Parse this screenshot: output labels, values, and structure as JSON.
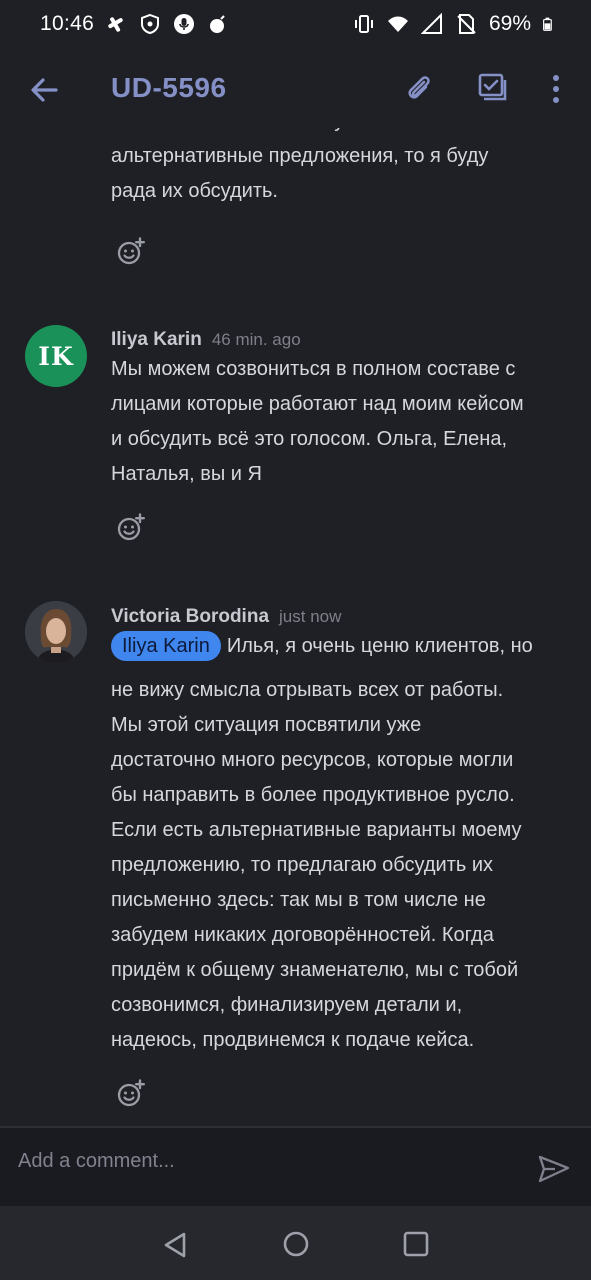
{
  "status_bar": {
    "time": "10:46",
    "battery": "69%"
  },
  "header": {
    "title": "UD-5596",
    "back_icon": "arrow-left-icon",
    "attach_icon": "paperclip-icon",
    "checklist_icon": "checklist-icon",
    "more_icon": "kebab-menu-icon",
    "accent_color": "#8490c6"
  },
  "comments": {
    "partial": {
      "lines": [
        "останется с нами. Если у тебя есть",
        "альтернативные предложения, то я буду",
        "рада их обсудить."
      ]
    },
    "items": [
      {
        "avatar_initials": "IK",
        "author": "Iliya Karin",
        "time": "46 min. ago",
        "lines": [
          "Мы можем созвониться в полном составе с",
          "лицами которые работают над моим кейсом",
          "и обсудить всё это голосом. Ольга, Елена,",
          "Наталья, вы и Я"
        ]
      },
      {
        "author": "Victoria Borodina",
        "time": "just now",
        "mention": "Iliya Karin",
        "first_line": "Илья, я очень ценю клиентов, но",
        "lines": [
          "не вижу смысла отрывать всех от работы.",
          "Мы этой ситуация посвятили уже",
          "достаточно много ресурсов, которые могли",
          "бы направить в более продуктивное русло.",
          "Если есть альтернативные варианты моему",
          "предложению, то предлагаю обсудить их",
          "письменно здесь: так мы в том числе не",
          "забудем никаких договорённостей. Когда",
          "придём к общему знаменателю, мы с тобой",
          "созвонимся, финализируем детали и,",
          "надеюсь, продвинемся к подаче кейса."
        ]
      }
    ]
  },
  "composer": {
    "placeholder": "Add a comment..."
  }
}
